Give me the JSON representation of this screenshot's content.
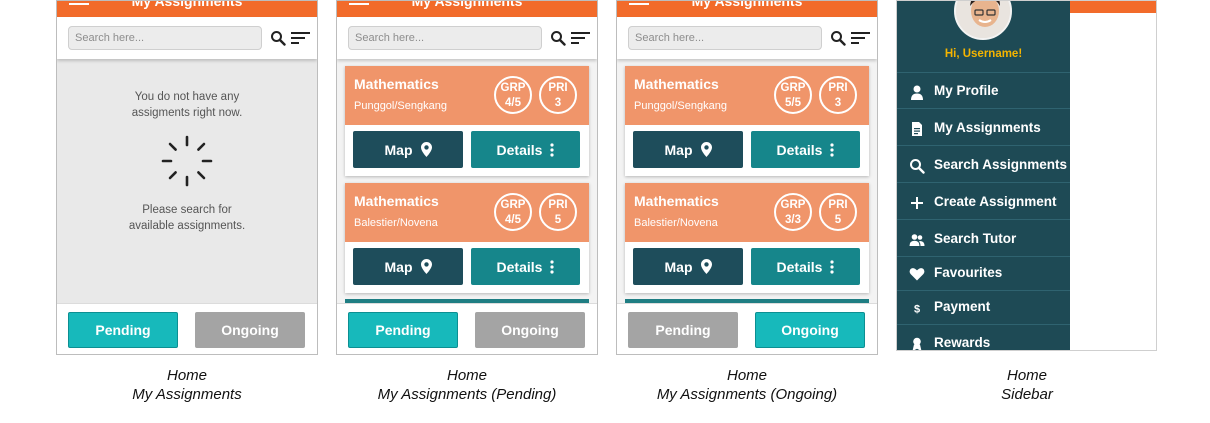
{
  "screens": [
    {
      "header": {
        "title": "My Assignments"
      },
      "search": {
        "placeholder": "Search here..."
      },
      "empty_state": {
        "line1": "You do not have any",
        "line2": "assigments right now.",
        "line3": "Please search for",
        "line4": "available assignments."
      },
      "tabs": {
        "left": "Pending",
        "right": "Ongoing",
        "active": "none"
      },
      "caption": {
        "line1": "Home",
        "line2": "My Assignments"
      }
    },
    {
      "header": {
        "title": "My Assignments"
      },
      "search": {
        "placeholder": "Search here..."
      },
      "cards": [
        {
          "subject": "Mathematics",
          "location": "Punggol/Sengkang",
          "grp_label": "GRP",
          "grp_value": "4/5",
          "pri_label": "PRI",
          "pri_value": "3",
          "map_label": "Map",
          "details_label": "Details"
        },
        {
          "subject": "Mathematics",
          "location": "Balestier/Novena",
          "grp_label": "GRP",
          "grp_value": "4/5",
          "pri_label": "PRI",
          "pri_value": "5",
          "map_label": "Map",
          "details_label": "Details"
        }
      ],
      "tabs": {
        "left": "Pending",
        "right": "Ongoing",
        "active": "left"
      },
      "caption": {
        "line1": "Home",
        "line2": "My Assignments (Pending)"
      }
    },
    {
      "header": {
        "title": "My Assignments"
      },
      "search": {
        "placeholder": "Search here..."
      },
      "cards": [
        {
          "subject": "Mathematics",
          "location": "Punggol/Sengkang",
          "grp_label": "GRP",
          "grp_value": "5/5",
          "pri_label": "PRI",
          "pri_value": "3",
          "map_label": "Map",
          "details_label": "Details"
        },
        {
          "subject": "Mathematics",
          "location": "Balestier/Novena",
          "grp_label": "GRP",
          "grp_value": "3/3",
          "pri_label": "PRI",
          "pri_value": "5",
          "map_label": "Map",
          "details_label": "Details"
        }
      ],
      "tabs": {
        "left": "Pending",
        "right": "Ongoing",
        "active": "right"
      },
      "caption": {
        "line1": "Home",
        "line2": "My Assignments (Ongoing)"
      }
    }
  ],
  "sidebar": {
    "greeting": "Hi, Username!",
    "items": [
      {
        "label": "My Profile",
        "icon": "person-icon"
      },
      {
        "label": "My Assignments",
        "icon": "document-icon"
      },
      {
        "label": "Search Assignments",
        "icon": "search-icon"
      },
      {
        "label": "Create Assignment",
        "icon": "plus-icon"
      },
      {
        "label": "Search Tutor",
        "icon": "people-icon"
      },
      {
        "label": "Favourites",
        "icon": "heart-icon"
      },
      {
        "label": "Payment",
        "icon": "dollar-icon"
      },
      {
        "label": "Rewards",
        "icon": "award-icon"
      }
    ],
    "caption": {
      "line1": "Home",
      "line2": "Sidebar"
    }
  },
  "colors": {
    "header_orange": "#f26b2a",
    "card_orange": "#f0956a",
    "map_button": "#1e4d5b",
    "details_button": "#16868b",
    "tab_active": "#17b9bb",
    "tab_inactive": "#a4a4a4",
    "sidebar_bg": "#1e4a55",
    "greeting_yellow": "#f5b400"
  }
}
